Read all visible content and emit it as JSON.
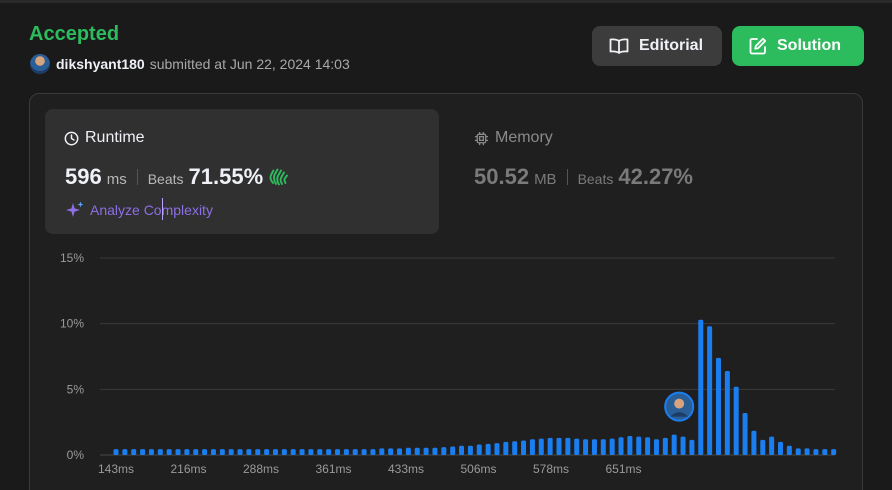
{
  "header": {
    "status": "Accepted",
    "username": "dikshyant180",
    "submitted_text": "submitted at Jun 22, 2024 14:03"
  },
  "buttons": {
    "editorial": "Editorial",
    "solution": "Solution"
  },
  "runtime": {
    "title": "Runtime",
    "value": "596",
    "unit": "ms",
    "beats_label": "Beats",
    "beats_pct": "71.55%",
    "analyze_label": "Analyze Complexity",
    "icon": "clock-icon"
  },
  "memory": {
    "title": "Memory",
    "value": "50.52",
    "unit": "MB",
    "beats_label": "Beats",
    "beats_pct": "42.27%",
    "icon": "chip-icon"
  },
  "colors": {
    "accepted": "#2cbb5d",
    "bar": "#1a7ef0",
    "analyze": "#8d6ee6"
  },
  "chart_data": {
    "type": "bar",
    "xlabel": "",
    "ylabel": "",
    "x_ticks": [
      "143ms",
      "216ms",
      "288ms",
      "361ms",
      "433ms",
      "506ms",
      "578ms",
      "651ms"
    ],
    "y_ticks": [
      "0%",
      "5%",
      "10%",
      "15%"
    ],
    "ylim": [
      0,
      15
    ],
    "grid": true,
    "marker_index": 63,
    "values": [
      0.45,
      0.45,
      0.45,
      0.45,
      0.45,
      0.45,
      0.45,
      0.45,
      0.45,
      0.45,
      0.45,
      0.45,
      0.45,
      0.45,
      0.45,
      0.45,
      0.45,
      0.45,
      0.45,
      0.45,
      0.45,
      0.45,
      0.45,
      0.45,
      0.45,
      0.45,
      0.45,
      0.45,
      0.45,
      0.45,
      0.5,
      0.5,
      0.5,
      0.55,
      0.55,
      0.55,
      0.55,
      0.6,
      0.65,
      0.7,
      0.7,
      0.8,
      0.85,
      0.9,
      1.0,
      1.05,
      1.1,
      1.2,
      1.25,
      1.3,
      1.3,
      1.3,
      1.25,
      1.2,
      1.2,
      1.2,
      1.25,
      1.35,
      1.45,
      1.4,
      1.35,
      1.2,
      1.3,
      1.55,
      1.4,
      1.15,
      10.3,
      9.8,
      7.4,
      6.4,
      5.2,
      3.2,
      1.85,
      1.15,
      1.4,
      1.0,
      0.7,
      0.5,
      0.5,
      0.45,
      0.45,
      0.45
    ]
  }
}
